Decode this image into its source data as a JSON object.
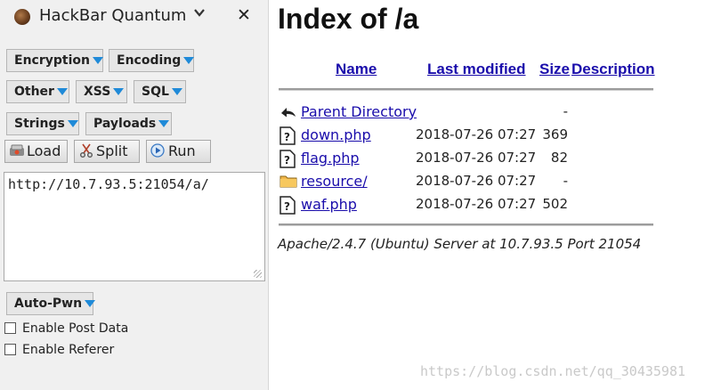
{
  "hackbar": {
    "title": "HackBar Quantum",
    "chevron_icon": "chevron-down-icon",
    "close_glyph": "✕",
    "menus": [
      "Encryption",
      "Encoding",
      "Other",
      "XSS",
      "SQL",
      "Strings",
      "Payloads"
    ],
    "actions": {
      "load_label": "Load",
      "split_label": "Split",
      "run_label": "Run"
    },
    "url_value": "http://10.7.93.5:21054/a/",
    "auto_pwn_label": "Auto-Pwn",
    "enable_post_label": "Enable Post Data",
    "enable_referer_label": "Enable Referer",
    "enable_post_checked": false,
    "enable_referer_checked": false
  },
  "listing": {
    "title": "Index of /a",
    "columns": {
      "name": "Name",
      "last_modified": "Last modified",
      "size": "Size",
      "description": "Description"
    },
    "rows": [
      {
        "icon": "back-arrow-icon",
        "name": "Parent Directory",
        "modified": "",
        "size": "-"
      },
      {
        "icon": "unknown-file-icon",
        "name": "down.php",
        "modified": "2018-07-26 07:27",
        "size": "369"
      },
      {
        "icon": "unknown-file-icon",
        "name": "flag.php",
        "modified": "2018-07-26 07:27",
        "size": "82"
      },
      {
        "icon": "folder-icon",
        "name": "resource/",
        "modified": "2018-07-26 07:27",
        "size": "-"
      },
      {
        "icon": "unknown-file-icon",
        "name": "waf.php",
        "modified": "2018-07-26 07:27",
        "size": "502"
      }
    ],
    "server_signature": "Apache/2.4.7 (Ubuntu) Server at 10.7.93.5 Port 21054"
  },
  "watermark": "https://blog.csdn.net/qq_30435981",
  "colors": {
    "link": "#1a0dab",
    "menu_arrow": "#1f8ad8",
    "sidebar_bg": "#f0f0f0"
  }
}
